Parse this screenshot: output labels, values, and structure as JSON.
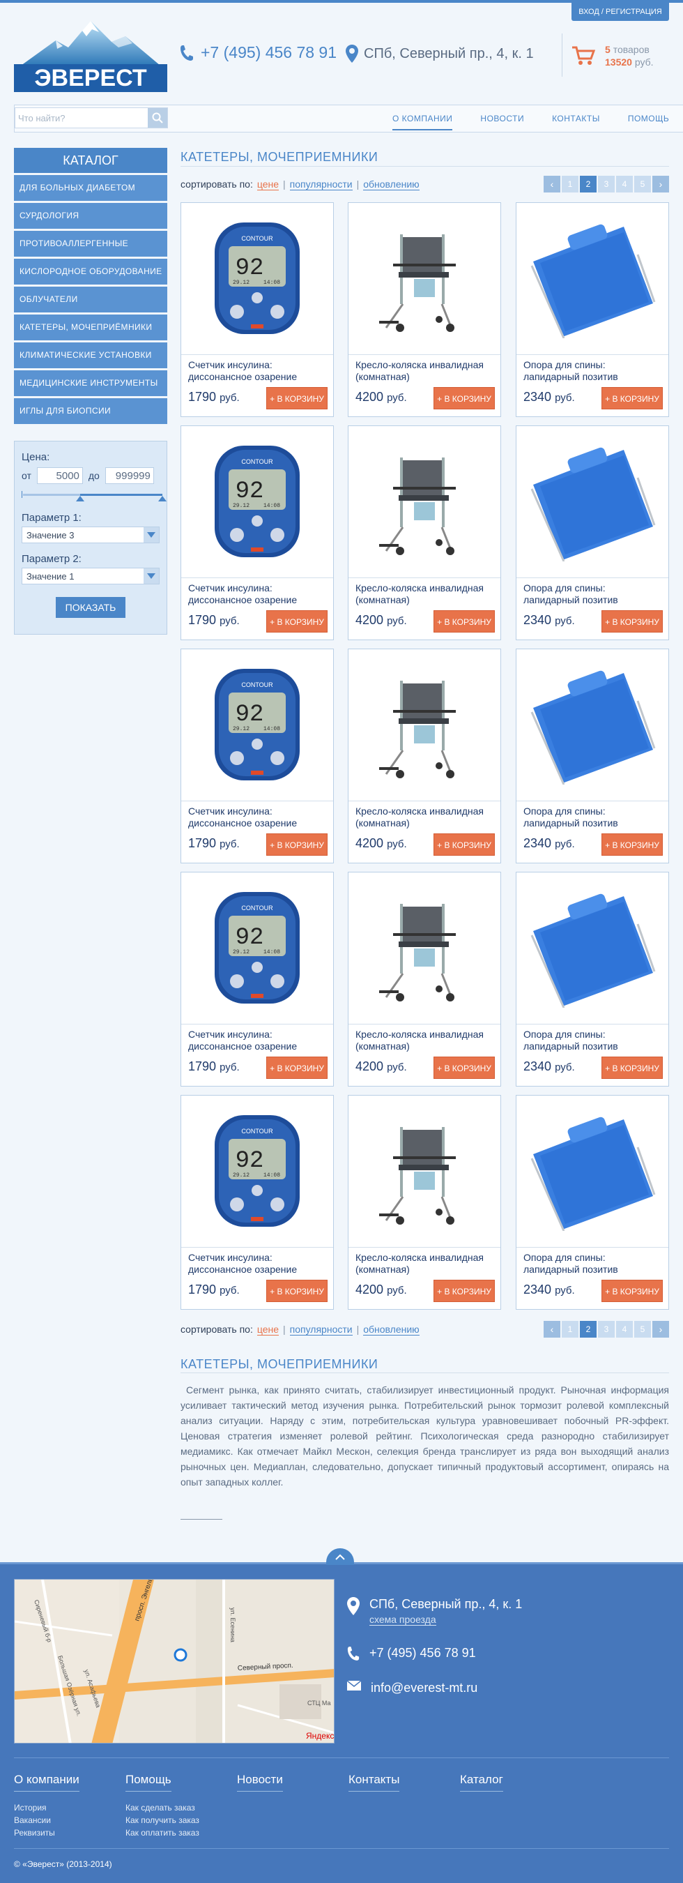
{
  "header": {
    "login_label": "ВХОД / РЕГИСТРАЦИЯ",
    "logo_text": "ЭВЕРЕСТ",
    "phone": "+7 (495) 456 78 91",
    "address": "СПб, Северный пр., 4, к. 1",
    "cart": {
      "count": "5",
      "count_label": "товаров",
      "sum": "13520",
      "currency": "руб."
    }
  },
  "search": {
    "placeholder": "Что найти?"
  },
  "nav": {
    "items": [
      "О КОМПАНИИ",
      "НОВОСТИ",
      "КОНТАКТЫ",
      "ПОМОЩЬ"
    ],
    "active_index": 0
  },
  "catalog": {
    "title": "КАТАЛОГ",
    "items": [
      "Для больных диабетом",
      "Сурдология",
      "Противоаллергенные",
      "Кислородное оборудование",
      "Облучатели",
      "Катетеры, мочеприёмники",
      "Климатические установки",
      "Медицинские инструменты",
      "Иглы для биопсии"
    ]
  },
  "filter": {
    "price_label": "Цена:",
    "from_label": "от",
    "from_value": "5000",
    "to_label": "до",
    "to_value": "999999",
    "param1_label": "Параметр 1:",
    "param1_value": "Значение 3",
    "param2_label": "Параметр 2:",
    "param2_value": "Значение 1",
    "submit_label": "ПОКАЗАТЬ"
  },
  "page_title": "КАТЕТЕРЫ, МОЧЕПРИЕМНИКИ",
  "sort": {
    "label": "сортировать по:",
    "options": [
      "цене",
      "популярности",
      "обновлению"
    ],
    "active_index": 0
  },
  "pager": {
    "prev": "‹",
    "next": "›",
    "pages": [
      "1",
      "2",
      "3",
      "4",
      "5"
    ],
    "current": "2"
  },
  "products": [
    {
      "name": "Счетчик инсулина: диссонансное озарение",
      "price": "1790",
      "currency": "руб.",
      "buy_label": "+ В КОРЗИНУ",
      "image": "glucometer"
    },
    {
      "name": "Кресло-коляска инвалидная (комнатная)",
      "price": "4200",
      "currency": "руб.",
      "buy_label": "+ В КОРЗИНУ",
      "image": "wheelchair"
    },
    {
      "name": "Опора для спины: лапидарный позитив",
      "price": "2340",
      "currency": "руб.",
      "buy_label": "+ В КОРЗИНУ",
      "image": "back-support"
    }
  ],
  "rows": 5,
  "meter": {
    "brand": "CONTOUR",
    "value": "92",
    "date": "29.12",
    "time": "14:08"
  },
  "description": {
    "title": "КАТЕТЕРЫ, МОЧЕПРИЕМНИКИ",
    "text": "Сегмент рынка, как принято считать, стабилизирует инвестиционный продукт. Рыночная информация усиливает тактический метод изучения рынка. Потребительский рынок тормозит ролевой комплексный анализ ситуации. Наряду с этим, потребительская культура уравновешивает побочный PR-эффект. Ценовая стратегия изменяет ролевой рейтинг. Психологическая среда разнородно стабилизирует медиамикс. Как отмечает Майкл Мескон, селекция бренда транслирует из ряда вон выходящий анализ рыночных цен. Медиаплан, следовательно, допускает типичный продуктовый ассортимент, опираясь на опыт западных коллег."
  },
  "footer": {
    "address": "СПб, Северный пр., 4, к. 1",
    "route_link": "схема проезда",
    "phone": "+7 (495) 456 78 91",
    "email": "info@everest-mt.ru",
    "map": {
      "streets": [
        "Северный просп.",
        "просп. Энгельса",
        "ул. Есенина",
        "Большая Озёрная ул.",
        "ул. Асафьева",
        "Сиреневый б-р"
      ],
      "brand": "Яндекс",
      "label": "СТЦ Ма"
    },
    "columns": [
      {
        "title": "О компании",
        "links": [
          "История",
          "Вакансии",
          "Реквизиты"
        ]
      },
      {
        "title": "Помощь",
        "links": [
          "Как сделать заказ",
          "Как получить заказ",
          "Как оплатить заказ"
        ]
      },
      {
        "title": "Новости",
        "links": []
      },
      {
        "title": "Контакты",
        "links": []
      },
      {
        "title": "Каталог",
        "links": []
      }
    ],
    "copyright": "© «Эверест» (2013-2014)"
  },
  "colors": {
    "brand": "#4a86c8",
    "accent": "#e8734a",
    "footer": "#4677bb"
  }
}
